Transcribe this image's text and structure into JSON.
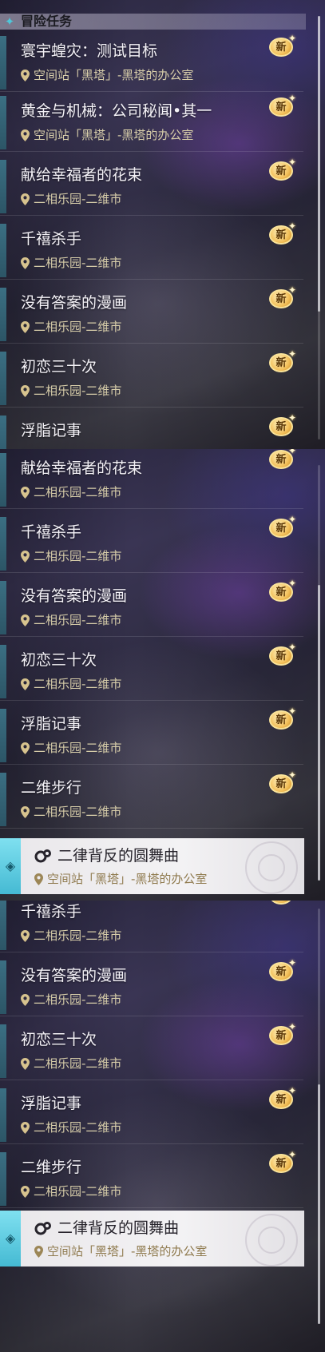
{
  "section": {
    "title": "冒险任务",
    "icon": "sparkle-diamond-icon"
  },
  "badge": {
    "label": "新"
  },
  "colors": {
    "accent": "#4fc7d9",
    "badge": "#f3c05a",
    "location_text": "#d7cda9",
    "selected_bg": "#f0eff2"
  },
  "panel1": {
    "items": [
      {
        "title": "寰宇蝗灾：测试目标",
        "location": "空间站「黑塔」-黑塔的办公室"
      },
      {
        "title": "黄金与机械：公司秘闻•其一",
        "location": "空间站「黑塔」-黑塔的办公室"
      },
      {
        "title": "献给幸福者的花束",
        "location": "二相乐园-二维市"
      },
      {
        "title": "千禧杀手",
        "location": "二相乐园-二维市"
      },
      {
        "title": "没有答案的漫画",
        "location": "二相乐园-二维市"
      },
      {
        "title": "初恋三十次",
        "location": "二相乐园-二维市"
      },
      {
        "title": "浮脂记事",
        "location": ""
      }
    ]
  },
  "panel2": {
    "items": [
      {
        "title": "献给幸福者的花束",
        "location": "二相乐园-二维市"
      },
      {
        "title": "千禧杀手",
        "location": "二相乐园-二维市"
      },
      {
        "title": "没有答案的漫画",
        "location": "二相乐园-二维市"
      },
      {
        "title": "初恋三十次",
        "location": "二相乐园-二维市"
      },
      {
        "title": "浮脂记事",
        "location": "二相乐园-二维市"
      },
      {
        "title": "二维步行",
        "location": "二相乐园-二维市"
      }
    ],
    "selected": {
      "title": "二律背反的圆舞曲",
      "location": "空间站「黑塔」-黑塔的办公室"
    }
  },
  "panel3": {
    "items": [
      {
        "title": "千禧杀手",
        "location": "二相乐园-二维市"
      },
      {
        "title": "没有答案的漫画",
        "location": "二相乐园-二维市"
      },
      {
        "title": "初恋三十次",
        "location": "二相乐园-二维市"
      },
      {
        "title": "浮脂记事",
        "location": "二相乐园-二维市"
      },
      {
        "title": "二维步行",
        "location": "二相乐园-二维市"
      }
    ],
    "selected": {
      "title": "二律背反的圆舞曲",
      "location": "空间站「黑塔」-黑塔的办公室"
    }
  }
}
